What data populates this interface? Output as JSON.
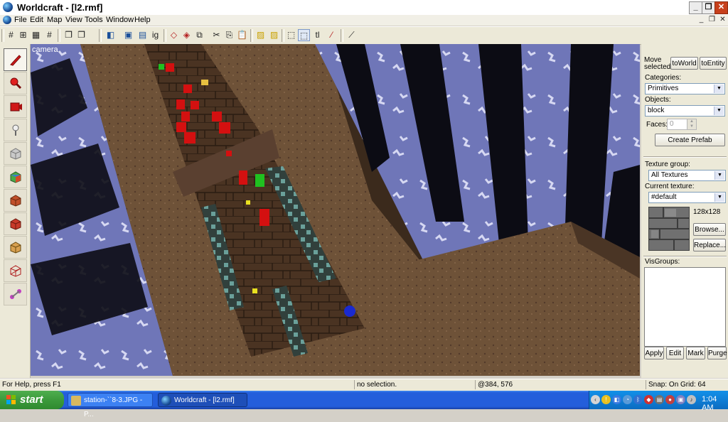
{
  "window": {
    "title": "Worldcraft - [l2.rmf]",
    "caption_buttons": [
      "_",
      "❐",
      "✕"
    ],
    "mdi_buttons": [
      "_",
      "❐",
      "✕"
    ]
  },
  "menu": [
    "File",
    "Edit",
    "Map",
    "View",
    "Tools",
    "Window",
    "Help"
  ],
  "toolbar": {
    "grid_label": "ig",
    "tl_label": "tl"
  },
  "viewport": {
    "label": "camera"
  },
  "right_panel": {
    "move_selected_line1": "Move",
    "move_selected_line2": "selected:",
    "to_world": "toWorld",
    "to_entity": "toEntity",
    "categories_label": "Categories:",
    "categories_value": "Primitives",
    "objects_label": "Objects:",
    "objects_value": "block",
    "faces_label": "Faces:",
    "faces_value": "0",
    "create_prefab": "Create Prefab",
    "texture_group_label": "Texture group:",
    "texture_group_value": "All Textures",
    "current_texture_label": "Current texture:",
    "current_texture_value": "#default",
    "texture_size": "128x128",
    "browse": "Browse...",
    "replace": "Replace...",
    "visgroups_label": "VisGroups:",
    "apply": "Apply",
    "edit": "Edit",
    "mark": "Mark",
    "purge": "Purge"
  },
  "statusbar": {
    "help": "For Help, press F1",
    "selection": "no selection.",
    "coords": "@384, 576",
    "snap": "Snap: On Grid: 64"
  },
  "taskbar": {
    "start": "start",
    "tasks": [
      {
        "label": "station-``8-3.JPG - P..."
      },
      {
        "label": "Worldcraft - [l2.rmf]"
      }
    ],
    "clock": "1:04 AM"
  },
  "colors": {
    "xp_blue": "#245edb",
    "start_green": "#3c9a3c",
    "panel_bg": "#ece9d8"
  }
}
